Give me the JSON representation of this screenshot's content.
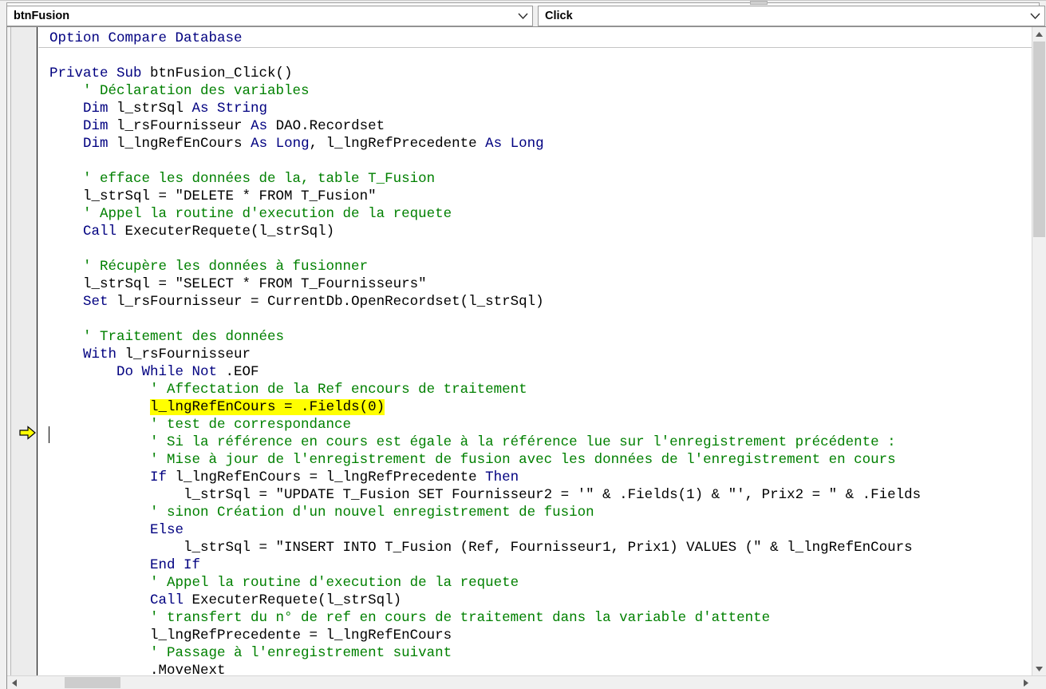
{
  "window": {
    "title_strip": ""
  },
  "toolbar": {
    "object_combo": {
      "name": "object-combo",
      "value": "btnFusion",
      "arrow_icon": "chevron-down-icon"
    },
    "procedure_combo": {
      "name": "procedure-combo",
      "value": "Click",
      "arrow_icon": "chevron-down-icon"
    }
  },
  "gutter": {
    "run_indicator_icon": "yellow-right-arrow-icon",
    "run_indicator_line": 21
  },
  "editor": {
    "highlighted_text": "l_lngRefEnCours = .Fields(0)",
    "colors": {
      "keyword": "#000080",
      "comment": "#008000",
      "text": "#000000",
      "highlight": "#ffff00",
      "background": "#ffffff",
      "gutter": "#ececec"
    },
    "lines": [
      {
        "n": 1,
        "segments": [
          {
            "t": "Option Compare Database",
            "c": "kw"
          }
        ]
      },
      {
        "n": 2,
        "segments": []
      },
      {
        "n": 3,
        "segments": [
          {
            "t": "Private Sub ",
            "c": "kw"
          },
          {
            "t": "btnFusion_Click()",
            "c": "tx"
          }
        ]
      },
      {
        "n": 4,
        "segments": [
          {
            "t": "    ' Déclaration des variables",
            "c": "cm"
          }
        ]
      },
      {
        "n": 5,
        "segments": [
          {
            "t": "    ",
            "c": "tx"
          },
          {
            "t": "Dim ",
            "c": "kw"
          },
          {
            "t": "l_strSql ",
            "c": "tx"
          },
          {
            "t": "As String",
            "c": "kw"
          }
        ]
      },
      {
        "n": 6,
        "segments": [
          {
            "t": "    ",
            "c": "tx"
          },
          {
            "t": "Dim ",
            "c": "kw"
          },
          {
            "t": "l_rsFournisseur ",
            "c": "tx"
          },
          {
            "t": "As ",
            "c": "kw"
          },
          {
            "t": "DAO.Recordset",
            "c": "tx"
          }
        ]
      },
      {
        "n": 7,
        "segments": [
          {
            "t": "    ",
            "c": "tx"
          },
          {
            "t": "Dim ",
            "c": "kw"
          },
          {
            "t": "l_lngRefEnCours ",
            "c": "tx"
          },
          {
            "t": "As Long",
            "c": "kw"
          },
          {
            "t": ", l_lngRefPrecedente ",
            "c": "tx"
          },
          {
            "t": "As Long",
            "c": "kw"
          }
        ]
      },
      {
        "n": 8,
        "segments": []
      },
      {
        "n": 9,
        "segments": [
          {
            "t": "    ' efface les données de la, table T_Fusion",
            "c": "cm"
          }
        ]
      },
      {
        "n": 10,
        "segments": [
          {
            "t": "    l_strSql = \"DELETE * FROM T_Fusion\"",
            "c": "tx"
          }
        ]
      },
      {
        "n": 11,
        "segments": [
          {
            "t": "    ' Appel la routine d'execution de la requete",
            "c": "cm"
          }
        ]
      },
      {
        "n": 12,
        "segments": [
          {
            "t": "    ",
            "c": "tx"
          },
          {
            "t": "Call ",
            "c": "kw"
          },
          {
            "t": "ExecuterRequete(l_strSql)",
            "c": "tx"
          }
        ]
      },
      {
        "n": 13,
        "segments": []
      },
      {
        "n": 14,
        "segments": [
          {
            "t": "    ' Récupère les données à fusionner",
            "c": "cm"
          }
        ]
      },
      {
        "n": 15,
        "segments": [
          {
            "t": "    l_strSql = \"SELECT * FROM T_Fournisseurs\"",
            "c": "tx"
          }
        ]
      },
      {
        "n": 16,
        "segments": [
          {
            "t": "    ",
            "c": "tx"
          },
          {
            "t": "Set ",
            "c": "kw"
          },
          {
            "t": "l_rsFournisseur = CurrentDb.OpenRecordset(l_strSql)",
            "c": "tx"
          }
        ]
      },
      {
        "n": 17,
        "segments": []
      },
      {
        "n": 18,
        "segments": [
          {
            "t": "    ' Traitement des données",
            "c": "cm"
          }
        ]
      },
      {
        "n": 19,
        "segments": [
          {
            "t": "    ",
            "c": "tx"
          },
          {
            "t": "With ",
            "c": "kw"
          },
          {
            "t": "l_rsFournisseur",
            "c": "tx"
          }
        ]
      },
      {
        "n": 20,
        "segments": [
          {
            "t": "        ",
            "c": "tx"
          },
          {
            "t": "Do While Not ",
            "c": "kw"
          },
          {
            "t": ".EOF",
            "c": "tx"
          }
        ]
      },
      {
        "n": 21,
        "segments": [
          {
            "t": "            ' Affectation de la Ref encours de traitement",
            "c": "cm"
          }
        ]
      },
      {
        "n": 22,
        "segments": [
          {
            "t": "            ",
            "c": "tx"
          },
          {
            "t": "l_lngRefEnCours = .Fields(0)",
            "c": "tx",
            "hl": true
          }
        ]
      },
      {
        "n": 23,
        "segments": [
          {
            "t": "            ' test de correspondance",
            "c": "cm"
          }
        ]
      },
      {
        "n": 24,
        "segments": [
          {
            "t": "            ' Si la référence en cours est égale à la référence lue sur l'enregistrement précédente :",
            "c": "cm"
          }
        ]
      },
      {
        "n": 25,
        "segments": [
          {
            "t": "            ' Mise à jour de l'enregistrement de fusion avec les données de l'enregistrement en cours",
            "c": "cm"
          }
        ]
      },
      {
        "n": 26,
        "segments": [
          {
            "t": "            ",
            "c": "tx"
          },
          {
            "t": "If ",
            "c": "kw"
          },
          {
            "t": "l_lngRefEnCours = l_lngRefPrecedente ",
            "c": "tx"
          },
          {
            "t": "Then",
            "c": "kw"
          }
        ]
      },
      {
        "n": 27,
        "segments": [
          {
            "t": "                l_strSql = \"UPDATE T_Fusion SET Fournisseur2 = '\" & .Fields(1) & \"', Prix2 = \" & .Fields",
            "c": "tx"
          }
        ]
      },
      {
        "n": 28,
        "segments": [
          {
            "t": "            ' sinon Création d'un nouvel enregistrement de fusion",
            "c": "cm"
          }
        ]
      },
      {
        "n": 29,
        "segments": [
          {
            "t": "            ",
            "c": "tx"
          },
          {
            "t": "Else",
            "c": "kw"
          }
        ]
      },
      {
        "n": 30,
        "segments": [
          {
            "t": "                l_strSql = \"INSERT INTO T_Fusion (Ref, Fournisseur1, Prix1) VALUES (\" & l_lngRefEnCours ",
            "c": "tx"
          }
        ]
      },
      {
        "n": 31,
        "segments": [
          {
            "t": "            ",
            "c": "tx"
          },
          {
            "t": "End If",
            "c": "kw"
          }
        ]
      },
      {
        "n": 32,
        "segments": [
          {
            "t": "            ' Appel la routine d'execution de la requete",
            "c": "cm"
          }
        ]
      },
      {
        "n": 33,
        "segments": [
          {
            "t": "            ",
            "c": "tx"
          },
          {
            "t": "Call ",
            "c": "kw"
          },
          {
            "t": "ExecuterRequete(l_strSql)",
            "c": "tx"
          }
        ]
      },
      {
        "n": 34,
        "segments": [
          {
            "t": "            ' transfert du n° de ref en cours de traitement dans la variable d'attente",
            "c": "cm"
          }
        ]
      },
      {
        "n": 35,
        "segments": [
          {
            "t": "            l_lngRefPrecedente = l_lngRefEnCours",
            "c": "tx"
          }
        ]
      },
      {
        "n": 36,
        "segments": [
          {
            "t": "            ' Passage à l'enregistrement suivant",
            "c": "cm"
          }
        ]
      },
      {
        "n": 37,
        "segments": [
          {
            "t": "            .MoveNext",
            "c": "tx"
          }
        ]
      }
    ]
  },
  "scrollbars": {
    "vertical": {
      "up_icon": "scroll-up-arrow-icon",
      "down_icon": "scroll-down-arrow-icon"
    },
    "horizontal": {
      "left_icon": "scroll-left-arrow-icon",
      "right_icon": "scroll-right-arrow-icon"
    }
  }
}
